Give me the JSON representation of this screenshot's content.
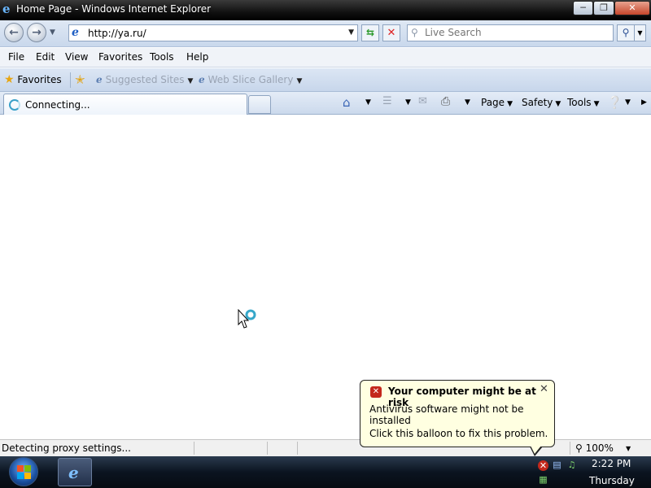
{
  "window": {
    "title": "Home Page - Windows Internet Explorer",
    "minimize": "─",
    "maximize": "❐",
    "close": "✕"
  },
  "address_bar": {
    "url": "http://ya.ru/",
    "search_placeholder": "Live Search"
  },
  "menu": [
    "File",
    "Edit",
    "View",
    "Favorites",
    "Tools",
    "Help"
  ],
  "favorites_bar": {
    "favorites_label": "Favorites",
    "links": [
      "Suggested Sites",
      "Web Slice Gallery"
    ]
  },
  "tab": {
    "label": "Connecting..."
  },
  "command_bar": {
    "page": "Page",
    "safety": "Safety",
    "tools": "Tools"
  },
  "status_bar": {
    "text": "Detecting proxy settings...",
    "zoom": "100%"
  },
  "balloon": {
    "title": "Your computer might be at risk",
    "line1": "Antivirus software might not be installed",
    "line2": "Click this balloon to fix this problem."
  },
  "clock": {
    "time": "2:22 PM",
    "day": "Thursday"
  },
  "colors": {
    "accent": "#1f5fc4",
    "error": "#c4281c",
    "balloon_bg": "#ffffe1"
  }
}
